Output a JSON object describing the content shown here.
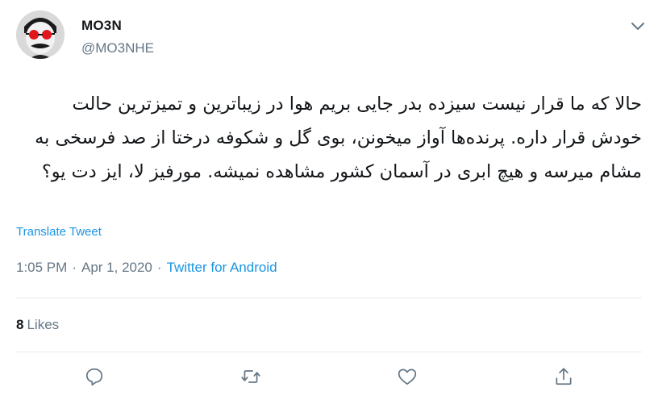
{
  "tweet": {
    "display_name": "MO3N",
    "handle": "@MO3NHE",
    "text": "حالا که ما قرار نیست سیزده بدر جایی بریم هوا در زیباترین و تمیزترین حالت خودش قرار داره. پرنده‌ها آواز میخونن، بوی گل و شکوفه درختا از صد فرسخی به مشام میرسه و هیچ ابری در آسمان کشور مشاهده نمیشه. مورفیز لا، ایز دت یو؟",
    "translate_label": "Translate Tweet",
    "time": "1:05 PM",
    "separator": "·",
    "date": "Apr 1, 2020",
    "source": "Twitter for Android",
    "likes_count": "8",
    "likes_label": "Likes"
  },
  "icons": {
    "caret": "chevron-down-icon",
    "reply": "reply-icon",
    "retweet": "retweet-icon",
    "like": "heart-icon",
    "share": "share-icon"
  },
  "colors": {
    "link": "#1b95e0",
    "secondary_text": "#657786",
    "primary_text": "#14171a",
    "divider": "#e6ecf0"
  }
}
